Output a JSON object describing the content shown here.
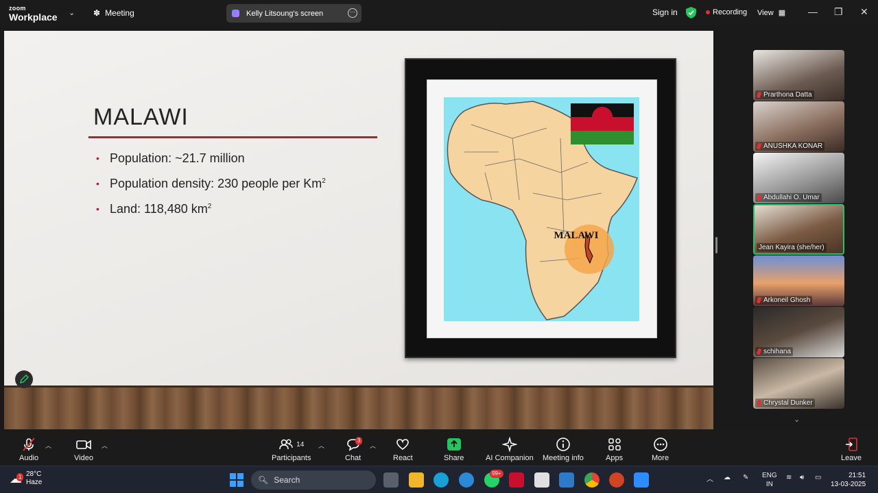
{
  "titlebar": {
    "logo_top": "zoom",
    "logo_bottom": "Workplace",
    "meeting_label": "Meeting",
    "screen_label": "Kelly Litsoung's screen",
    "sign_in": "Sign in",
    "recording": "Recording",
    "view": "View"
  },
  "slide": {
    "title": "MALAWI",
    "bullets": [
      {
        "text": "Population: ~21.7 million",
        "sup": ""
      },
      {
        "text": "Population density: 230 people per Km",
        "sup": "2"
      },
      {
        "text": "Land: 118,480 km",
        "sup": "2"
      }
    ],
    "map_label": "MALAWI"
  },
  "participants": [
    {
      "name": "Prarthona Datta",
      "active": false
    },
    {
      "name": "ANUSHKA KONAR",
      "active": false
    },
    {
      "name": "Abdullahi O. Umar",
      "active": false
    },
    {
      "name": "Jean Kayira (she/her)",
      "active": true
    },
    {
      "name": "Arkoneil Ghosh",
      "active": false
    },
    {
      "name": "schihana",
      "active": false
    },
    {
      "name": "Chrystal Dunker",
      "active": false
    }
  ],
  "toolbar": {
    "audio": "Audio",
    "video": "Video",
    "participants": "Participants",
    "participants_count": "14",
    "chat": "Chat",
    "chat_badge": "3",
    "react": "React",
    "share": "Share",
    "ai_companion": "AI Companion",
    "meeting_info": "Meeting info",
    "apps": "Apps",
    "more": "More",
    "leave": "Leave"
  },
  "taskbar": {
    "weather_badge": "1",
    "temperature": "28°C",
    "condition": "Haze",
    "search_placeholder": "Search",
    "whatsapp_badge": "99+",
    "lang_line1": "ENG",
    "lang_line2": "IN",
    "time": "21:51",
    "date": "13-03-2025"
  },
  "colors": {
    "accent_red": "#b0203a",
    "active_green": "#27c26a",
    "share_green": "#22c55e"
  }
}
